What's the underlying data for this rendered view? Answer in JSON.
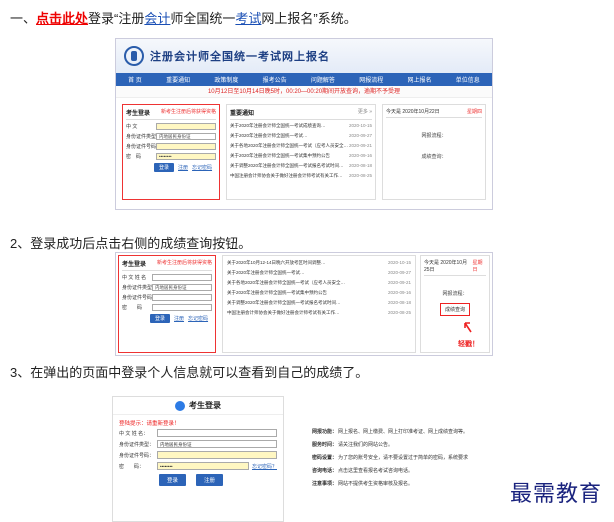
{
  "steps": {
    "step1_prefix": "一、",
    "step1_link": "点击此处",
    "step1_mid": "登录“注册",
    "step1_kw1": "会计",
    "step1_mid2": "师全国统一",
    "step1_kw2": "考试",
    "step1_suffix": "网上报名”系统。",
    "step2": "2、登录成功后点击右侧的成绩查询按钮。",
    "step3": "3、在弹出的页面中登录个人信息就可以查看到自己的成绩了。"
  },
  "shot1": {
    "title": "注册会计师全国统一考试网上报名",
    "nav": [
      "首 页",
      "重要通知",
      "政策制度",
      "报考公告",
      "问题解答",
      "网报流程",
      "网上报名",
      "单位信息"
    ],
    "notice": "10月12日至10月14日晚5时，00:20—00:20期间开放查询，逾期不予受理",
    "login": {
      "title": "考生登录",
      "note": "新考生注册后将获得资格",
      "rows": [
        {
          "label": "中 文",
          "value": ""
        },
        {
          "label": "身份证件类型",
          "value": "内地居民身份证"
        },
        {
          "label": "身份证件号码",
          "value": ""
        },
        {
          "label": "密　码",
          "value": "••••••••"
        }
      ],
      "btn": "登录",
      "links": [
        "注册",
        "忘记密码"
      ]
    },
    "news": {
      "title": "重要通知",
      "more": "更多 »",
      "items": [
        {
          "t": "关于2020年注册会计师全国统一考试成绩查询…",
          "d": "2020-10-15"
        },
        {
          "t": "关于2020年注册会计师全国统一考试…",
          "d": "2020-09-27"
        },
        {
          "t": "关于各地2020年注册会计师全国统一考试（应考人员安全…",
          "d": "2020-09-21"
        },
        {
          "t": "关于2020年注册会计师全国统一考试集中预约公告",
          "d": "2020-09-16"
        },
        {
          "t": "关于调整2020年注册会计师全国统一考试报名考试时间…",
          "d": "2020-08-18"
        },
        {
          "t": "中国注册会计师协会关于做好注册会计师考试有关工作…",
          "d": "2020-08-25"
        }
      ]
    },
    "side": {
      "date": "今天是 2020年10月22日",
      "status": "星期四",
      "line1": "网报流程：",
      "line2": "成绩查询："
    }
  },
  "shot2": {
    "login_title": "考生登录",
    "login_note": "新考生注册后将获得资格",
    "rows": [
      {
        "label": "中 文 姓 名",
        "value": ""
      },
      {
        "label": "身份证件类型",
        "value": "内地居民身份证"
      },
      {
        "label": "身份证件号码",
        "value": ""
      },
      {
        "label": "密　　码",
        "value": ""
      }
    ],
    "btn": "登录",
    "links": [
      "注册",
      "忘记密码"
    ],
    "news": [
      {
        "t": "关于2020年10月12-14日晚六开放考区时间调整…",
        "d": "2020-10-15"
      },
      {
        "t": "关于2020年注册会计师全国统一考试…",
        "d": "2020-09-27"
      },
      {
        "t": "关于各地2020年注册会计师全国统一考试（应考人员安全…",
        "d": "2020-09-21"
      },
      {
        "t": "关于2020年注册会计师全国统一考试集中预约公告",
        "d": "2020-09-16"
      },
      {
        "t": "关于调整2020年注册会计师全国统一考试报名考试时间…",
        "d": "2020-08-18"
      },
      {
        "t": "中国注册会计师协会关于做好注册会计师考试有关工作…",
        "d": "2020-08-25"
      }
    ],
    "side_date": "今天是 2020年10月25日",
    "side_status": "星期日",
    "side_label": "网报流程：",
    "score_btn": "成绩查询",
    "tap": "轻戳！"
  },
  "shot3": {
    "title": "考生登录",
    "warn": "登陆提示：请重新登录！",
    "rows": [
      {
        "label": "中 文 姓 名：",
        "value": ""
      },
      {
        "label": "身份证件类型：",
        "value": "内地居民身份证"
      },
      {
        "label": "身份证件号码：",
        "value": ""
      },
      {
        "label": "密　　码：",
        "value": "••••••••"
      }
    ],
    "forgot": "忘记密码？",
    "btn_login": "登录",
    "btn_register": "注册"
  },
  "info": [
    {
      "k": "网报功能：",
      "v": "网上报名、网上缴费、网上打印准考证、网上成绩查询等。"
    },
    {
      "k": "服务时间：",
      "v": "请关注我们的网站公告。"
    },
    {
      "k": "密码设置：",
      "v": "为了您的账号安全，请不要设置过于简单的密码，系统要求"
    },
    {
      "k": "咨询电话：",
      "v": "点击这里查看报名考试咨询电话。"
    },
    {
      "k": "注意事项：",
      "v": "网站不提供考生资格审核及报名。"
    }
  ],
  "watermark": "最需教育"
}
